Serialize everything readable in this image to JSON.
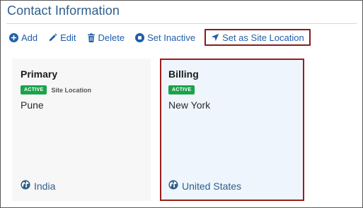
{
  "header": {
    "title": "Contact Information"
  },
  "toolbar": {
    "add_label": "Add",
    "edit_label": "Edit",
    "delete_label": "Delete",
    "set_inactive_label": "Set Inactive",
    "set_site_location_label": "Set as Site Location"
  },
  "cards": [
    {
      "title": "Primary",
      "status_badge": "ACTIVE",
      "note": "Site Location",
      "city": "Pune",
      "country": "India"
    },
    {
      "title": "Billing",
      "status_badge": "ACTIVE",
      "city": "New York",
      "country": "United States"
    }
  ],
  "colors": {
    "accent": "#1f5ea8",
    "title": "#2f5e8c",
    "active_badge": "#1aa34a",
    "highlight_border": "#8b1a1a",
    "selected_card_bg": "#eef5fc"
  },
  "icons": {
    "add": "plus-circle-icon",
    "edit": "pencil-icon",
    "delete": "trash-icon",
    "set_inactive": "stop-circle-icon",
    "set_site_location": "location-arrow-icon",
    "country": "globe-icon"
  }
}
